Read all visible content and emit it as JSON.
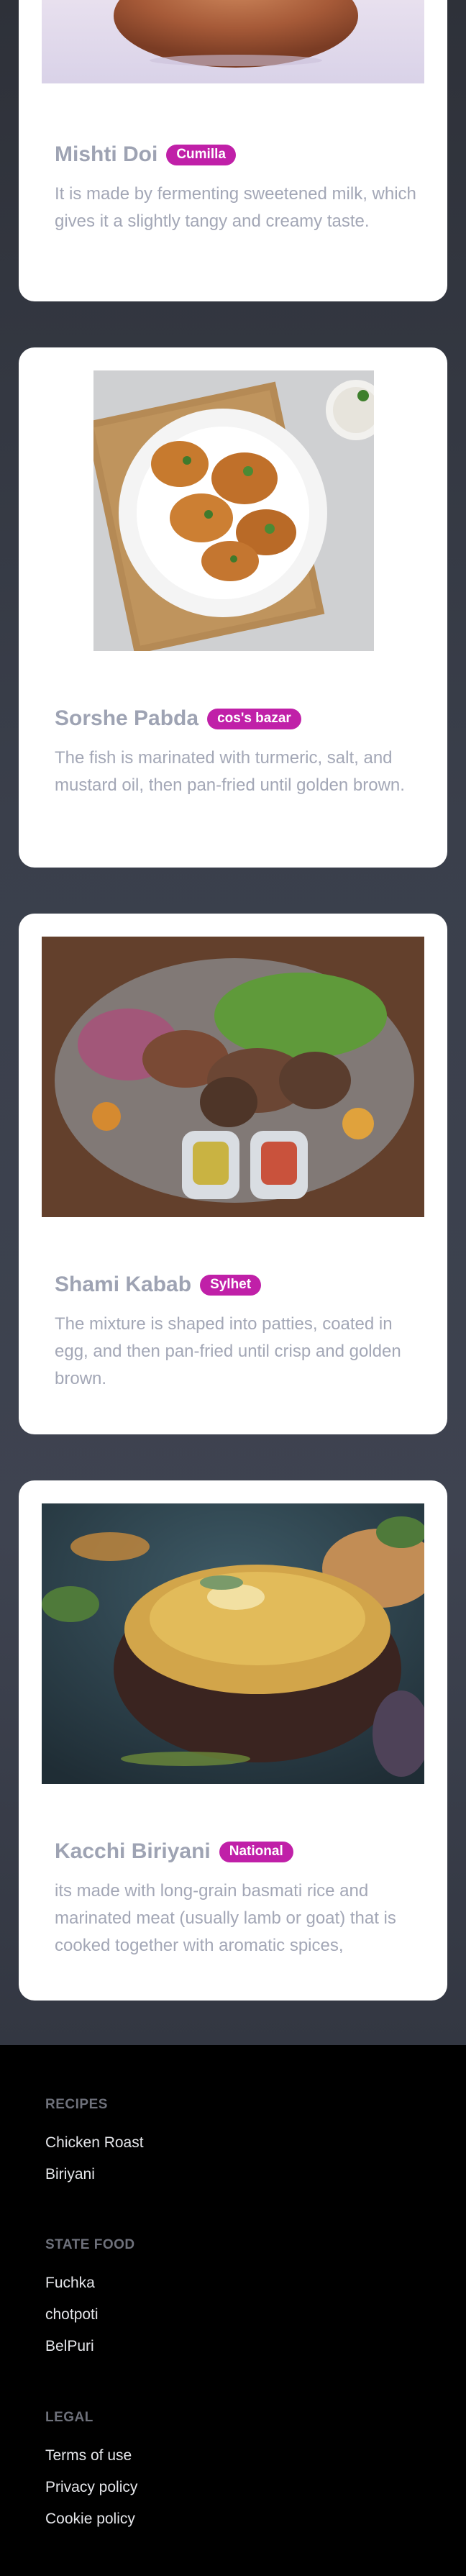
{
  "dishes": [
    {
      "name": "Mishti Doi",
      "region": "Cumilla",
      "description": "It is made by fermenting sweetened milk, which gives it a slightly tangy and creamy taste."
    },
    {
      "name": "Sorshe Pabda",
      "region": "cos's bazar",
      "description": "The fish is marinated with turmeric, salt, and mustard oil, then pan-fried until golden brown."
    },
    {
      "name": "Shami Kabab",
      "region": "Sylhet",
      "description": "The mixture is shaped into patties, coated in egg, and then pan-fried until crisp and golden brown."
    },
    {
      "name": "Kacchi Biriyani",
      "region": "National",
      "description": "its made with long-grain basmati rice and marinated meat (usually lamb or goat) that is cooked together with aromatic spices,"
    }
  ],
  "footer": {
    "recipes": {
      "heading": "RECIPES",
      "links": [
        "Chicken Roast",
        "Biriyani"
      ]
    },
    "state_food": {
      "heading": "STATE FOOD",
      "links": [
        "Fuchka",
        "chotpoti",
        "BelPuri"
      ]
    },
    "legal": {
      "heading": "LEGAL",
      "links": [
        "Terms of use",
        "Privacy policy",
        "Cookie policy"
      ]
    }
  },
  "colors": {
    "badge": "#c020a8",
    "title": "#9ea3b3",
    "description": "#a3a7b6",
    "footer_bg": "#000000"
  }
}
